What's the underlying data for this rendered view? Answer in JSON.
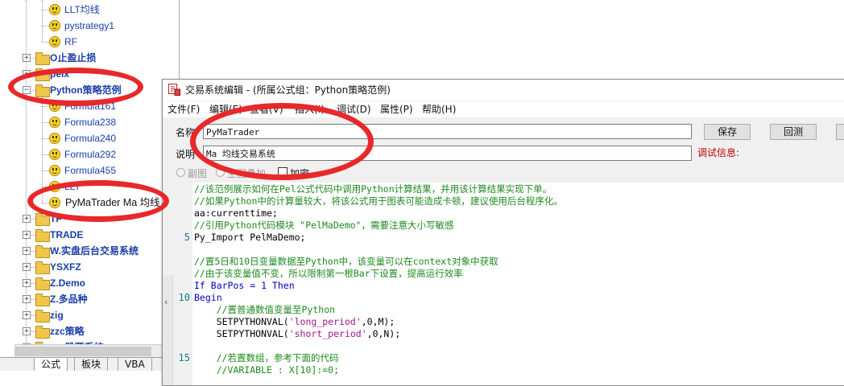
{
  "tree": {
    "items": [
      {
        "label": "LLT均线",
        "kind": "formula",
        "level": 2
      },
      {
        "label": "pystrategy1",
        "kind": "formula",
        "level": 2
      },
      {
        "label": "RF",
        "kind": "formula",
        "level": 2
      },
      {
        "label": "O止盈止损",
        "kind": "folder",
        "level": 1,
        "expander": "+"
      },
      {
        "label": "pelx",
        "kind": "folder",
        "level": 1,
        "expander": "+"
      },
      {
        "label": "Python策略范例",
        "kind": "folder",
        "level": 1,
        "expander": "−"
      },
      {
        "label": "Formula161",
        "kind": "formula",
        "level": 2
      },
      {
        "label": "Formula238",
        "kind": "formula",
        "level": 2
      },
      {
        "label": "Formula240",
        "kind": "formula",
        "level": 2
      },
      {
        "label": "Formula292",
        "kind": "formula",
        "level": 2
      },
      {
        "label": "Formula455",
        "kind": "formula",
        "level": 2
      },
      {
        "label": "LLT",
        "kind": "formula",
        "level": 2
      },
      {
        "label": "PyMaTrader Ma 均线",
        "kind": "formula",
        "level": 2,
        "selected": true
      },
      {
        "label": "TF",
        "kind": "folder",
        "level": 1,
        "expander": "+"
      },
      {
        "label": "TRADE",
        "kind": "folder",
        "level": 1,
        "expander": "+"
      },
      {
        "label": "W.实盘后台交易系统",
        "kind": "folder",
        "level": 1,
        "expander": "+"
      },
      {
        "label": "YSXFZ",
        "kind": "folder",
        "level": 1,
        "expander": "+"
      },
      {
        "label": "Z.Demo",
        "kind": "folder",
        "level": 1,
        "expander": "+"
      },
      {
        "label": "Z.多品种",
        "kind": "folder",
        "level": 1,
        "expander": "+"
      },
      {
        "label": "zig",
        "kind": "folder",
        "level": 1,
        "expander": "+"
      },
      {
        "label": "zzc策略",
        "kind": "folder",
        "level": 1,
        "expander": "+"
      },
      {
        "label": "zzc股票系统",
        "kind": "folder",
        "level": 1,
        "expander": "+"
      }
    ],
    "bottom_tabs": [
      "公式",
      "板块",
      "VBA"
    ]
  },
  "dialog": {
    "title": "交易系统编辑 - (所属公式组：Python策略范例)",
    "menus": [
      "文件(F)",
      "编辑(E)",
      "查看(V)",
      "插入(I)",
      "调试(D)",
      "属性(P)",
      "帮助(H)"
    ],
    "name_label": "名称",
    "name_value": "PyMaTrader",
    "desc_label": "说明",
    "desc_value": "Ma 均线交易系统",
    "save_label": "保存",
    "test_label": "回测",
    "debug_label": "调试信息:",
    "opt_sub": "副图",
    "opt_main": "主图叠加",
    "opt_encrypt": "加密"
  },
  "code": {
    "lines": [
      {
        "n": "",
        "parts": [
          {
            "t": "//该范例展示如何在Pel公式代码中调用Python计算结果，并用该计算结果实现下单。",
            "c": "comment"
          }
        ]
      },
      {
        "n": "",
        "parts": [
          {
            "t": "//如果Python中的计算量较大，将该公式用于图表可能造成卡顿，建议使用后台程序化。",
            "c": "comment"
          }
        ]
      },
      {
        "n": "",
        "parts": [
          {
            "t": "aa:currenttime;",
            "c": "plain"
          }
        ]
      },
      {
        "n": "",
        "parts": [
          {
            "t": "//引用Python代码模块 \"PelMaDemo\"，需要注意大小写敏感",
            "c": "comment"
          }
        ]
      },
      {
        "n": "5",
        "parts": [
          {
            "t": "Py_Import PelMaDemo;",
            "c": "plain"
          }
        ]
      },
      {
        "n": "",
        "parts": []
      },
      {
        "n": "",
        "parts": [
          {
            "t": "//置5日和10日变量数据至Python中，该变量可以在context对象中获取",
            "c": "comment"
          }
        ]
      },
      {
        "n": "",
        "parts": [
          {
            "t": "//由于该变量值不变，所以限制第一根Bar下设置，提高运行效率",
            "c": "comment"
          }
        ]
      },
      {
        "n": "",
        "parts": [
          {
            "t": "If BarPos = 1 Then",
            "c": "kw"
          }
        ]
      },
      {
        "n": "10",
        "parts": [
          {
            "t": "Begin",
            "c": "kw"
          }
        ]
      },
      {
        "n": "",
        "parts": [
          {
            "t": "    //置普通数值变量至Python",
            "c": "comment"
          }
        ]
      },
      {
        "n": "",
        "parts": [
          {
            "t": "    SETPYTHONVAL(",
            "c": "plain"
          },
          {
            "t": "'long_period'",
            "c": "str"
          },
          {
            "t": ",0,M);",
            "c": "plain"
          }
        ]
      },
      {
        "n": "",
        "parts": [
          {
            "t": "    SETPYTHONVAL(",
            "c": "plain"
          },
          {
            "t": "'short_period'",
            "c": "str"
          },
          {
            "t": ",0,N);",
            "c": "plain"
          }
        ]
      },
      {
        "n": "",
        "parts": []
      },
      {
        "n": "15",
        "parts": [
          {
            "t": "    //若置数组，参考下面的代码",
            "c": "comment"
          }
        ]
      },
      {
        "n": "",
        "parts": [
          {
            "t": "    //VARIABLE : X[10]:=0;",
            "c": "comment"
          }
        ]
      }
    ]
  },
  "colors": {
    "annotation": "#e8282a",
    "tree_text": "#1a3fa8",
    "comment": "#1e8a1e",
    "keyword": "#0000c8",
    "string": "#a0148c",
    "debug": "#c00000"
  }
}
